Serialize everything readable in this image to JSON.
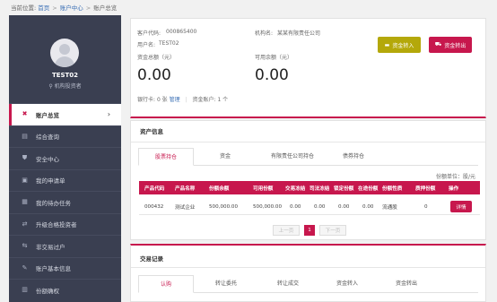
{
  "breadcrumb": {
    "prefix": "当前位置:",
    "items": [
      "首页",
      "账户中心",
      "账户总览"
    ],
    "separator": ">"
  },
  "sidebar": {
    "user_name": "TEST02",
    "user_role": "机构投资者",
    "items": [
      {
        "label": "账户总览",
        "icon": "account-overview-icon",
        "active": true
      },
      {
        "label": "综合查询",
        "icon": "query-icon"
      },
      {
        "label": "安全中心",
        "icon": "shield-icon"
      },
      {
        "label": "我的申请单",
        "icon": "application-icon"
      },
      {
        "label": "我的待办任务",
        "icon": "task-icon"
      },
      {
        "label": "升级合格投资者",
        "icon": "upgrade-icon"
      },
      {
        "label": "非交易过户",
        "icon": "transfer-icon"
      },
      {
        "label": "账户基本信息",
        "icon": "edit-icon"
      },
      {
        "label": "份额确权",
        "icon": "document-icon"
      }
    ]
  },
  "summary": {
    "customer_code_label": "客户代码:",
    "customer_code": "000865400",
    "org_name_label": "机构名:",
    "org_name": "某某有限责任公司",
    "username_label": "用户名:",
    "username": "TEST02",
    "total_funds_label": "资金总额（元）",
    "total_funds": "0.00",
    "available_label": "可用余额（元）",
    "available": "0.00",
    "deposit_button": "资金转入",
    "withdraw_button": "资金转出",
    "bank_card_label": "银行卡:",
    "bank_card_count": "0 张",
    "manage_link": "管理",
    "fund_account_label": "资金账户:",
    "fund_account_count": "1 个"
  },
  "assets": {
    "title": "资产信息",
    "tabs": [
      "股票持仓",
      "资金",
      "有限责任公司持仓",
      "债券持仓"
    ],
    "unit": "份额单位：股/元",
    "columns": [
      "产品代码",
      "产品名称",
      "份额余额",
      "可用份额",
      "交易冻结",
      "司法冻结",
      "锁定份额",
      "在途份额",
      "份额性质",
      "质押份额",
      "操作"
    ],
    "rows": [
      [
        "000432",
        "测试企业",
        "500,000.00",
        "500,000.00",
        "0.00",
        "0.00",
        "0.00",
        "0.00",
        "流通股",
        "0",
        "详情"
      ]
    ],
    "pager": {
      "prev": "上一页",
      "current": "1",
      "next": "下一页"
    }
  },
  "trades": {
    "title": "交易记录",
    "tabs": [
      "认购",
      "转让委托",
      "转让成交",
      "资金转入",
      "资金转出"
    ]
  },
  "colors": {
    "accent": "#c7174d",
    "deposit": "#b4a80a",
    "sidebar": "#3a3f51"
  }
}
